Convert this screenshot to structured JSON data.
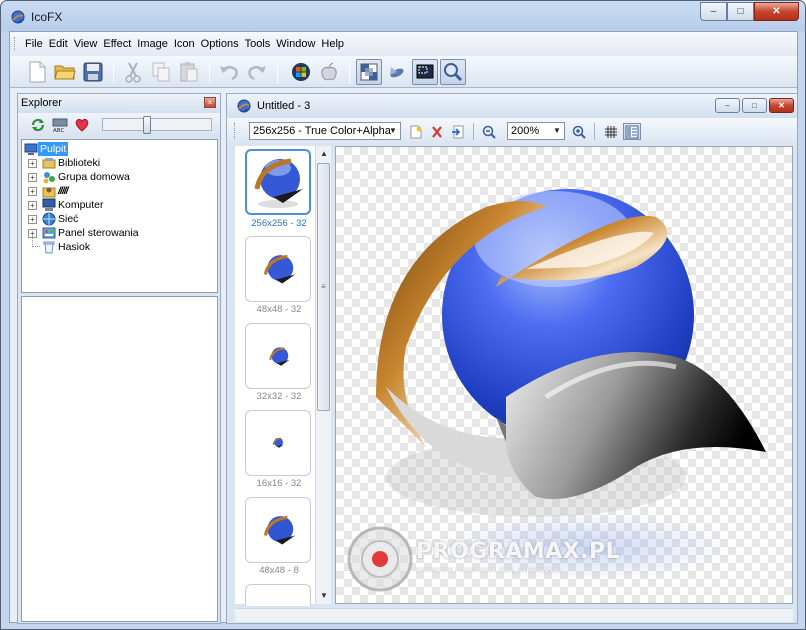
{
  "app": {
    "title": "IcoFX"
  },
  "window_buttons": {
    "minimize": "–",
    "maximize": "□",
    "close": "✕"
  },
  "menu": [
    "File",
    "Edit",
    "View",
    "Effect",
    "Image",
    "Icon",
    "Options",
    "Tools",
    "Window",
    "Help"
  ],
  "toolbar_icons": [
    "new-icon",
    "open-folder-icon",
    "save-icon",
    "cut-icon",
    "copy-icon",
    "paste-icon",
    "undo-icon",
    "redo-icon",
    "windows-logo-icon",
    "apple-logo-icon",
    "image-grid-icon",
    "fly-icon",
    "capture-icon",
    "zoom-icon"
  ],
  "explorer": {
    "title": "Explorer",
    "close": "×",
    "tree": [
      {
        "label": "Pulpit",
        "selected": true
      },
      {
        "label": "Biblioteki"
      },
      {
        "label": "Grupa domowa"
      },
      {
        "label": "/////"
      },
      {
        "label": "Komputer"
      },
      {
        "label": "Sieć"
      },
      {
        "label": "Panel sterowania"
      },
      {
        "label": "Hasiok"
      }
    ]
  },
  "document": {
    "title": "Untitled - 3",
    "format_select": "256x256 - True Color+Alpha",
    "zoom_select": "200%",
    "thumbnails": [
      {
        "label": "256x256 - 32",
        "selected": true
      },
      {
        "label": "48x48 - 32"
      },
      {
        "label": "32x32 - 32"
      },
      {
        "label": "16x16 - 32"
      },
      {
        "label": "48x48 - 8"
      }
    ]
  },
  "watermark": {
    "name": "PROGRAMAX.PL",
    "tagline": "DARMOWE PROGRAMY, GRY, STEROWNIKI"
  },
  "colors": {
    "accent": "#3399ff",
    "selection_border": "#4a8fd9",
    "close": "#c7452e"
  }
}
